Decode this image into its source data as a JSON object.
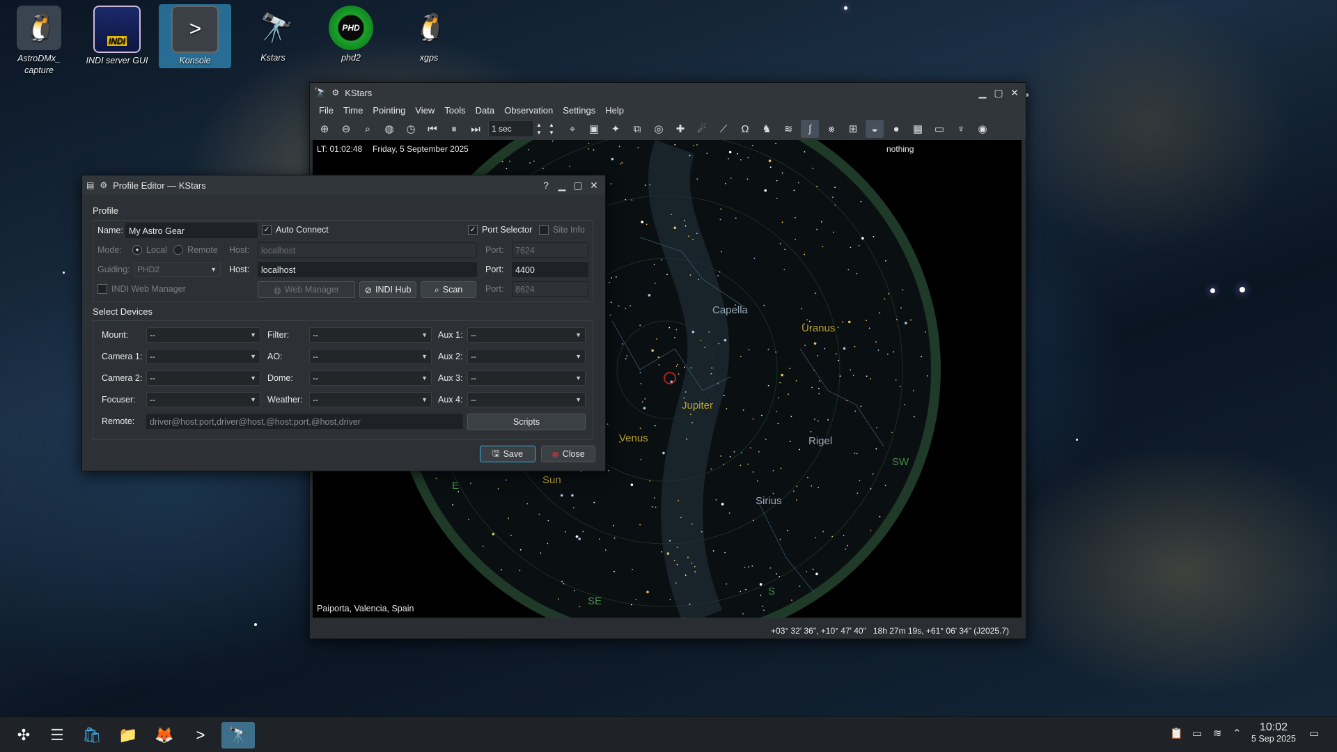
{
  "desktop": {
    "icons": [
      {
        "label": "AstroDMx_\ncapture",
        "icon": "penguin-camera-icon"
      },
      {
        "label": "INDI server GUI",
        "icon": "indi-icon"
      },
      {
        "label": "Konsole",
        "icon": "terminal-icon"
      },
      {
        "label": "Kstars",
        "icon": "telescope-icon"
      },
      {
        "label": "phd2",
        "icon": "phd2-icon"
      },
      {
        "label": "xgps",
        "icon": "penguin-icon"
      }
    ]
  },
  "kstars": {
    "title": "KStars",
    "menu": [
      "File",
      "Time",
      "Pointing",
      "View",
      "Tools",
      "Data",
      "Observation",
      "Settings",
      "Help"
    ],
    "time_step": "1 sec",
    "local_time": "LT: 01:02:48",
    "date": "Friday, 5 September 2025",
    "focus_object": "nothing",
    "location": "Paiporta, Valencia, Spain",
    "status_coords": "+03° 32' 36\", +10° 47' 40\"   18h 27m 19s, +61° 06' 34\" (J2025.7)",
    "sky_labels": [
      "Capella",
      "Uranus",
      "Jupiter",
      "Venus",
      "Sun",
      "Rigel",
      "Sirius"
    ],
    "horizon_labels": [
      "SW",
      "S",
      "SE",
      "E"
    ]
  },
  "profile_editor": {
    "title": "Profile Editor — KStars",
    "profile_group": "Profile",
    "name_label": "Name:",
    "name_value": "My Astro Gear",
    "auto_connect": "Auto Connect",
    "port_selector": "Port Selector",
    "site_info": "Site Info",
    "mode_label": "Mode:",
    "mode_local": "Local",
    "mode_remote": "Remote",
    "host_label": "Host:",
    "host_local_value": "localhost",
    "port_label": "Port:",
    "port_local_value": "7624",
    "guiding_label": "Guiding:",
    "guiding_value": "PHD2",
    "guide_host_value": "localhost",
    "guide_port_value": "4400",
    "indi_web_manager": "INDI Web Manager",
    "web_manager_btn": "Web Manager",
    "indi_hub_btn": "INDI Hub",
    "scan_btn": "Scan",
    "web_port_value": "8624",
    "devices_group": "Select Devices",
    "devices": {
      "col1": [
        {
          "label": "Mount:",
          "value": "--"
        },
        {
          "label": "Camera 1:",
          "value": "--"
        },
        {
          "label": "Camera 2:",
          "value": "--"
        },
        {
          "label": "Focuser:",
          "value": "--"
        }
      ],
      "col2": [
        {
          "label": "Filter:",
          "value": "--"
        },
        {
          "label": "AO:",
          "value": "--"
        },
        {
          "label": "Dome:",
          "value": "--"
        },
        {
          "label": "Weather:",
          "value": "--"
        }
      ],
      "col3": [
        {
          "label": "Aux 1:",
          "value": "--"
        },
        {
          "label": "Aux 2:",
          "value": "--"
        },
        {
          "label": "Aux 3:",
          "value": "--"
        },
        {
          "label": "Aux 4:",
          "value": "--"
        }
      ]
    },
    "remote_label": "Remote:",
    "remote_placeholder": "driver@host:port,driver@host,@host:port,@host,driver",
    "scripts_btn": "Scripts",
    "save_btn": "Save",
    "close_btn": "Close"
  },
  "taskbar": {
    "time": "10:02",
    "date": "5 Sep 2025"
  }
}
